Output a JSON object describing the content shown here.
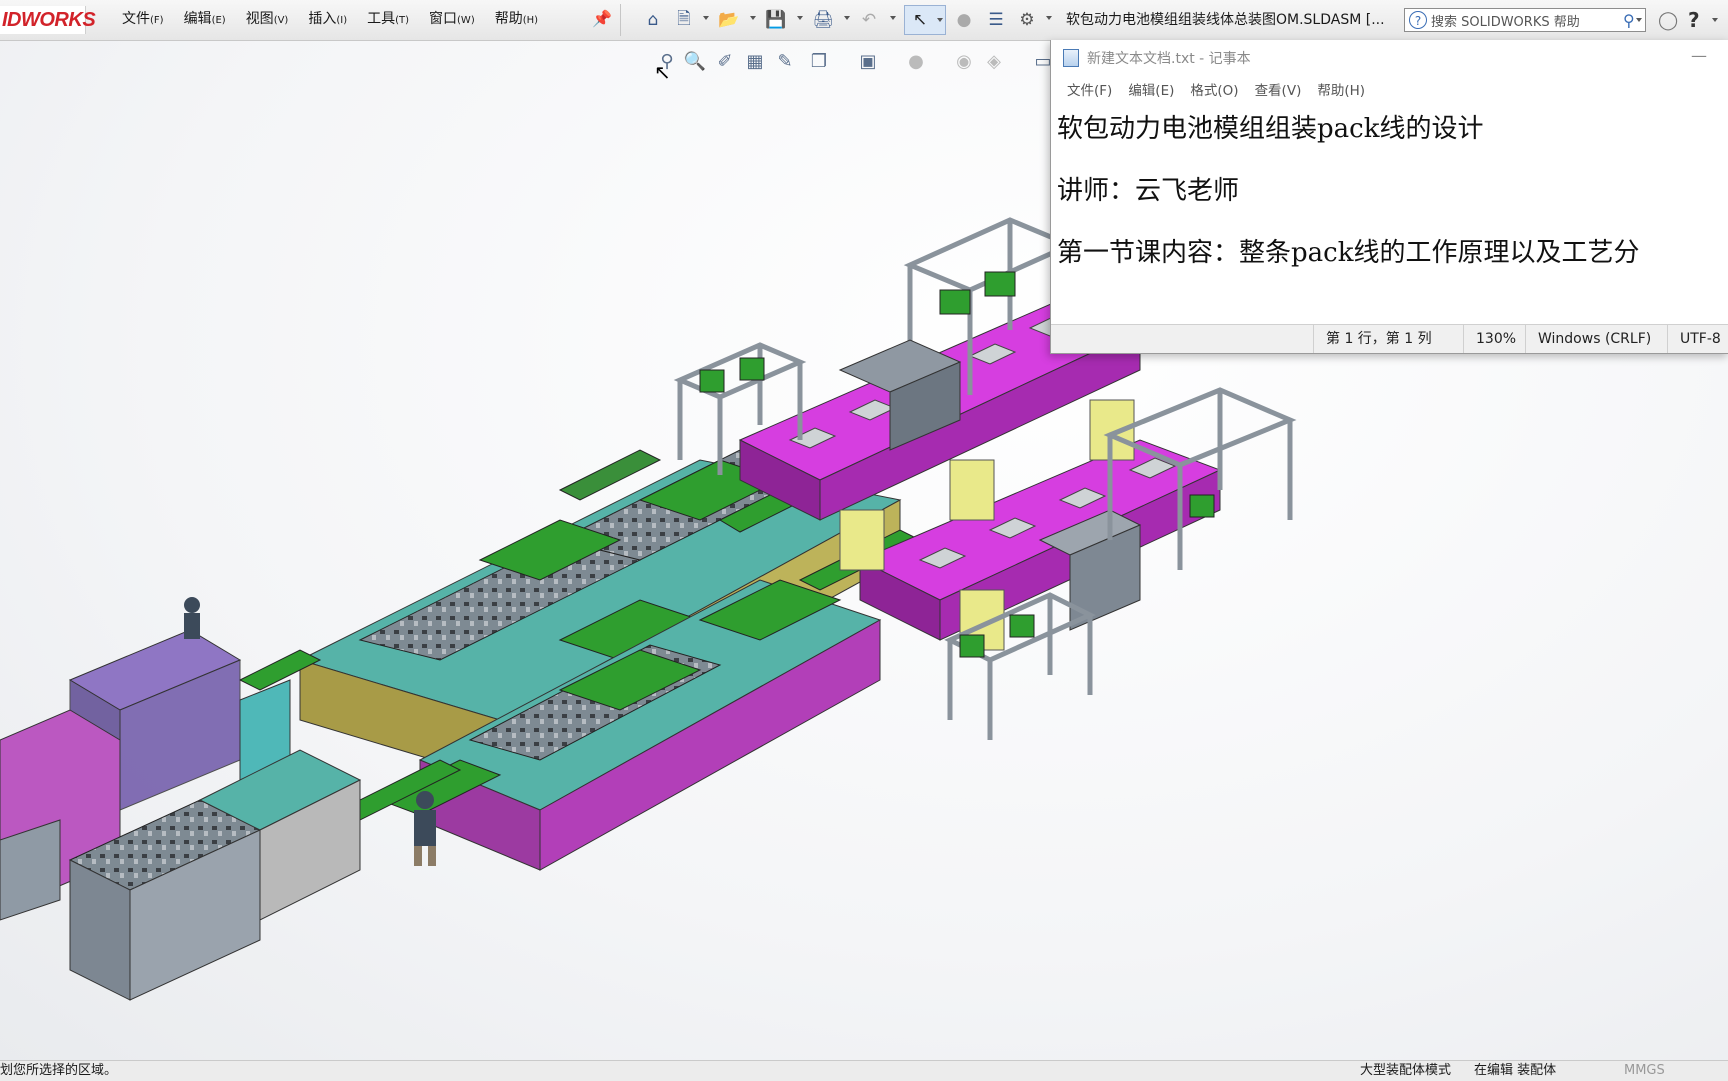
{
  "solidworks": {
    "logo_text": "IDWORKS",
    "menu": [
      {
        "label": "文件",
        "key": "(F)"
      },
      {
        "label": "编辑",
        "key": "(E)"
      },
      {
        "label": "视图",
        "key": "(V)"
      },
      {
        "label": "插入",
        "key": "(I)"
      },
      {
        "label": "工具",
        "key": "(T)"
      },
      {
        "label": "窗口",
        "key": "(W)"
      },
      {
        "label": "帮助",
        "key": "(H)"
      }
    ],
    "document_title": "软包动力电池模组组装线体总装图OM.SLDASM [...",
    "search_placeholder": "搜索 SOLIDWORKS 帮助",
    "icons": [
      "home-icon",
      "new-document-icon",
      "open-icon",
      "save-icon",
      "print-icon",
      "undo-icon",
      "select-icon",
      "rebuild-icon",
      "file-properties-icon",
      "options-icon"
    ],
    "status_left": "划您所选择的区域。",
    "status_mode": "大型装配体模式",
    "status_editing": "在编辑 装配体",
    "status_units": "MMGS"
  },
  "notepad": {
    "title": "新建文本文档.txt - 记事本",
    "menu": [
      "文件(F)",
      "编辑(E)",
      "格式(O)",
      "查看(V)",
      "帮助(H)"
    ],
    "lines": [
      "软包动力电池模组组装pack线的设计",
      "讲师：云飞老师",
      "第一节课内容：整条pack线的工作原理以及工艺分"
    ],
    "status": {
      "position": "第 1 行，第 1 列",
      "zoom": "130%",
      "line_ending": "Windows (CRLF)",
      "encoding": "UTF-8"
    }
  },
  "colors": {
    "magenta_conveyor": "#d63ee0",
    "green_plate": "#2f9e2f",
    "frame_gray": "#9aa3ad",
    "yellow_guard": "#e9e98a",
    "olive_cabinet": "#bdb35a",
    "teal_cabinet": "#4fb8b8",
    "purple_enclosure": "#7b5bb0"
  }
}
